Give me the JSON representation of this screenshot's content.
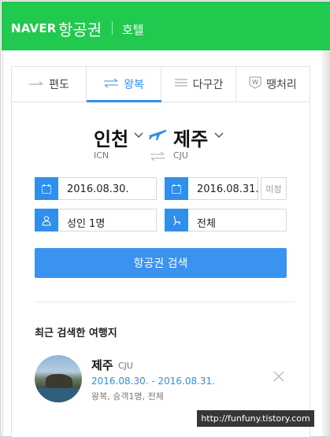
{
  "header": {
    "logo": "NAVER",
    "title": "항공권",
    "subtitle": "호텔"
  },
  "tabs": [
    {
      "label": "편도",
      "icon": "one-way-arrow-icon",
      "active": false
    },
    {
      "label": "왕복",
      "icon": "round-trip-arrows-icon",
      "active": true
    },
    {
      "label": "다구간",
      "icon": "multi-city-lines-icon",
      "active": false
    },
    {
      "label": "땡처리",
      "icon": "w-deal-badge-icon",
      "active": false
    }
  ],
  "route": {
    "origin_city": "인천",
    "origin_code": "ICN",
    "destination_city": "제주",
    "destination_code": "CJU"
  },
  "form": {
    "depart_date": "2016.08.30.",
    "return_date": "2016.08.31.",
    "undecided_label": "미정",
    "passengers": "성인 1명",
    "seat_class": "전체",
    "search_button": "항공권 검색"
  },
  "recent": {
    "title": "최근 검색한 여행지",
    "items": [
      {
        "city": "제주",
        "code": "CJU",
        "dates": "2016.08.30. - 2016.08.31.",
        "info": "왕복, 승객1명, 전체"
      }
    ]
  },
  "watermark": "http://funfuny.tistory.com",
  "colors": {
    "brand_green": "#21c94f",
    "accent_blue": "#2f8fea"
  }
}
